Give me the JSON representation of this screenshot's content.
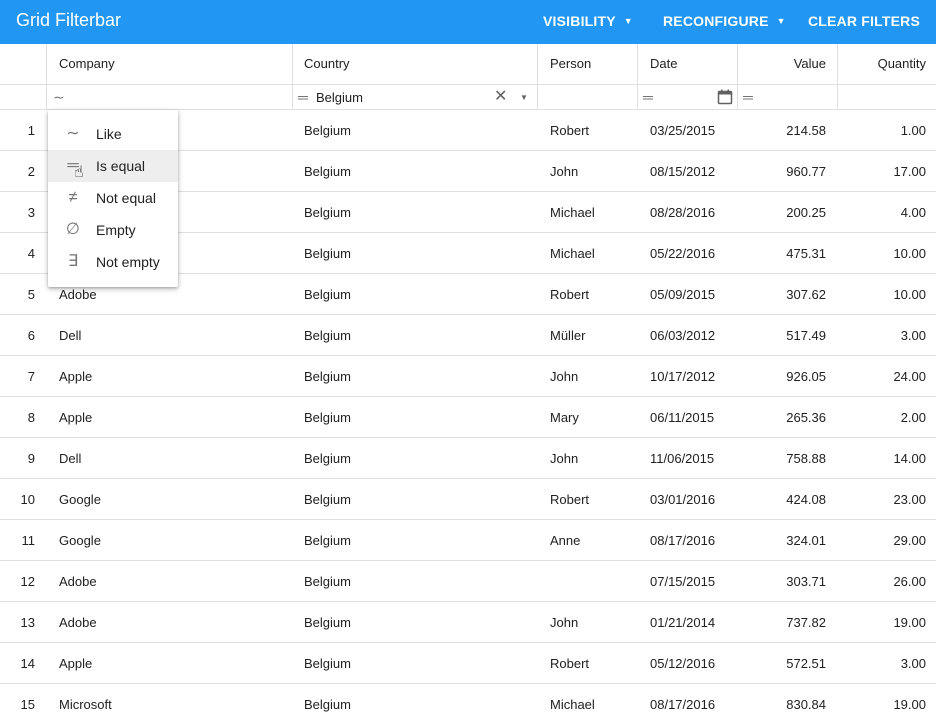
{
  "app": {
    "title": "Grid Filterbar",
    "buttons": {
      "visibility": "VISIBILITY",
      "reconfigure": "RECONFIGURE",
      "clear_filters": "CLEAR FILTERS"
    },
    "accent": "#2196f3"
  },
  "grid": {
    "columns": [
      "Company",
      "Country",
      "Person",
      "Date",
      "Value",
      "Quantity"
    ],
    "filters": {
      "company_op": "∼",
      "country_op": "═",
      "country_value": "Belgium",
      "date_op": "═",
      "value_op": "═"
    },
    "rows": [
      [
        "1",
        "",
        "Belgium",
        "Robert",
        "03/25/2015",
        "214.58",
        "1.00"
      ],
      [
        "2",
        "",
        "Belgium",
        "John",
        "08/15/2012",
        "960.77",
        "17.00"
      ],
      [
        "3",
        "",
        "Belgium",
        "Michael",
        "08/28/2016",
        "200.25",
        "4.00"
      ],
      [
        "4",
        "",
        "Belgium",
        "Michael",
        "05/22/2016",
        "475.31",
        "10.00"
      ],
      [
        "5",
        "Adobe",
        "Belgium",
        "Robert",
        "05/09/2015",
        "307.62",
        "10.00"
      ],
      [
        "6",
        "Dell",
        "Belgium",
        "Müller",
        "06/03/2012",
        "517.49",
        "3.00"
      ],
      [
        "7",
        "Apple",
        "Belgium",
        "John",
        "10/17/2012",
        "926.05",
        "24.00"
      ],
      [
        "8",
        "Apple",
        "Belgium",
        "Mary",
        "06/11/2015",
        "265.36",
        "2.00"
      ],
      [
        "9",
        "Dell",
        "Belgium",
        "John",
        "11/06/2015",
        "758.88",
        "14.00"
      ],
      [
        "10",
        "Google",
        "Belgium",
        "Robert",
        "03/01/2016",
        "424.08",
        "23.00"
      ],
      [
        "11",
        "Google",
        "Belgium",
        "Anne",
        "08/17/2016",
        "324.01",
        "29.00"
      ],
      [
        "12",
        "Adobe",
        "Belgium",
        "",
        "07/15/2015",
        "303.71",
        "26.00"
      ],
      [
        "13",
        "Adobe",
        "Belgium",
        "John",
        "01/21/2014",
        "737.82",
        "19.00"
      ],
      [
        "14",
        "Apple",
        "Belgium",
        "Robert",
        "05/12/2016",
        "572.51",
        "3.00"
      ],
      [
        "15",
        "Microsoft",
        "Belgium",
        "Michael",
        "08/17/2016",
        "830.84",
        "19.00"
      ]
    ]
  },
  "filter_menu": {
    "items": [
      {
        "label": "Like",
        "icon": "∼"
      },
      {
        "label": "Is equal",
        "icon": "═"
      },
      {
        "label": "Not equal",
        "icon": "≠"
      },
      {
        "label": "Empty",
        "icon": "∅"
      },
      {
        "label": "Not empty",
        "icon": "∃"
      }
    ],
    "hovered": "Is equal"
  }
}
